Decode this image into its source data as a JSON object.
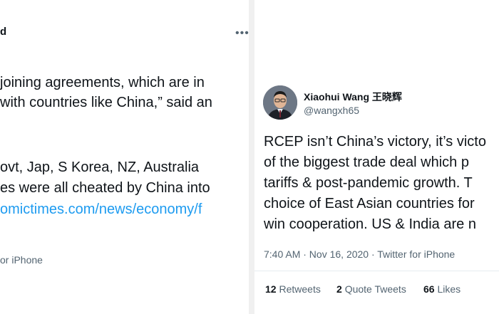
{
  "left_tweet": {
    "name_fragment": "d",
    "more_icon": "more-horizontal-icon",
    "lines": [
      "joining agreements, which are in",
      "with countries like China,” said an",
      "",
      "ovt, Jap, S Korea, NZ, Australia",
      "es were all cheated by China into"
    ],
    "link_text": "omictimes.com/news/economy/f",
    "source": "or iPhone"
  },
  "right_tweet": {
    "name": "Xiaohui Wang 王晓辉",
    "handle": "@wangxh65",
    "avatar": "avatar",
    "lines": [
      "RCEP isn’t China’s victory, it’s victo",
      "of the biggest trade deal which p",
      "tariffs & post-pandemic growth. T",
      "choice of East Asian countries for",
      "win cooperation. US & India are n"
    ],
    "timestamp": "7:40 AM · Nov 16, 2020 · Twitter for iPhone",
    "stats": [
      {
        "count": "12",
        "label": "Retweets"
      },
      {
        "count": "2",
        "label": "Quote Tweets"
      },
      {
        "count": "66",
        "label": "Likes"
      }
    ]
  }
}
